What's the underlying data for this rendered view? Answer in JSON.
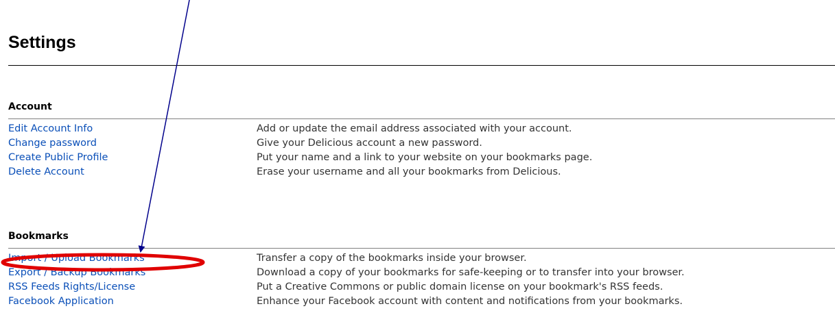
{
  "page": {
    "title": "Settings"
  },
  "sections": [
    {
      "heading": "Account",
      "rows": [
        {
          "link": "Edit Account Info",
          "description": "Add or update the email address associated with your account."
        },
        {
          "link": "Change password",
          "description": "Give your Delicious account a new password."
        },
        {
          "link": "Create Public Profile",
          "description": "Put your name and a link to your website on your bookmarks page."
        },
        {
          "link": "Delete Account",
          "description": "Erase your username and all your bookmarks from Delicious."
        }
      ]
    },
    {
      "heading": "Bookmarks",
      "rows": [
        {
          "link": "Import / Upload Bookmarks",
          "description": "Transfer a copy of the bookmarks inside your browser."
        },
        {
          "link": "Export / Backup Bookmarks",
          "description": "Download a copy of your bookmarks for safe-keeping or to transfer into your browser."
        },
        {
          "link": "RSS Feeds Rights/License",
          "description": "Put a Creative Commons or public domain license on your bookmark's RSS feeds."
        },
        {
          "link": "Facebook Application",
          "description": "Enhance your Facebook account with content and notifications from your bookmarks."
        }
      ]
    }
  ],
  "colors": {
    "link": "#0a4fb8",
    "annotation_arrow": "#00008b",
    "annotation_ellipse": "#e00000"
  },
  "annotation": {
    "arrow_icon": "pointer-arrow-icon",
    "highlight_icon": "highlight-ellipse-icon"
  }
}
